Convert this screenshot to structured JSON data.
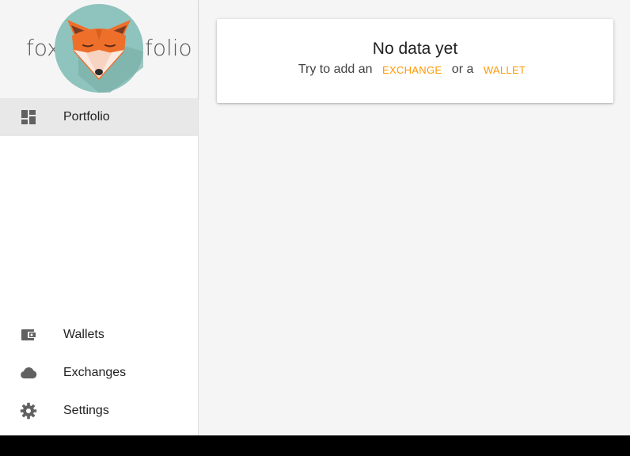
{
  "logo": {
    "left_text": "fox",
    "right_text": "folio"
  },
  "sidebar": {
    "primary": [
      {
        "label": "Portfolio",
        "icon": "dashboard-icon",
        "active": true
      }
    ],
    "secondary": [
      {
        "label": "Wallets",
        "icon": "wallet-icon"
      },
      {
        "label": "Exchanges",
        "icon": "cloud-icon"
      },
      {
        "label": "Settings",
        "icon": "gear-icon"
      }
    ]
  },
  "empty_state": {
    "title": "No data yet",
    "prefix": "Try to add an",
    "exchange_link": "EXCHANGE",
    "middle": "or a",
    "wallet_link": "WALLET"
  },
  "colors": {
    "accent": "#ff9800",
    "fox_orange": "#ee6f2a",
    "badge_teal": "#8fc3bd",
    "content_bg": "#f5f5f5",
    "active_item_bg": "#e8e8e8",
    "icon_gray": "#616161"
  }
}
